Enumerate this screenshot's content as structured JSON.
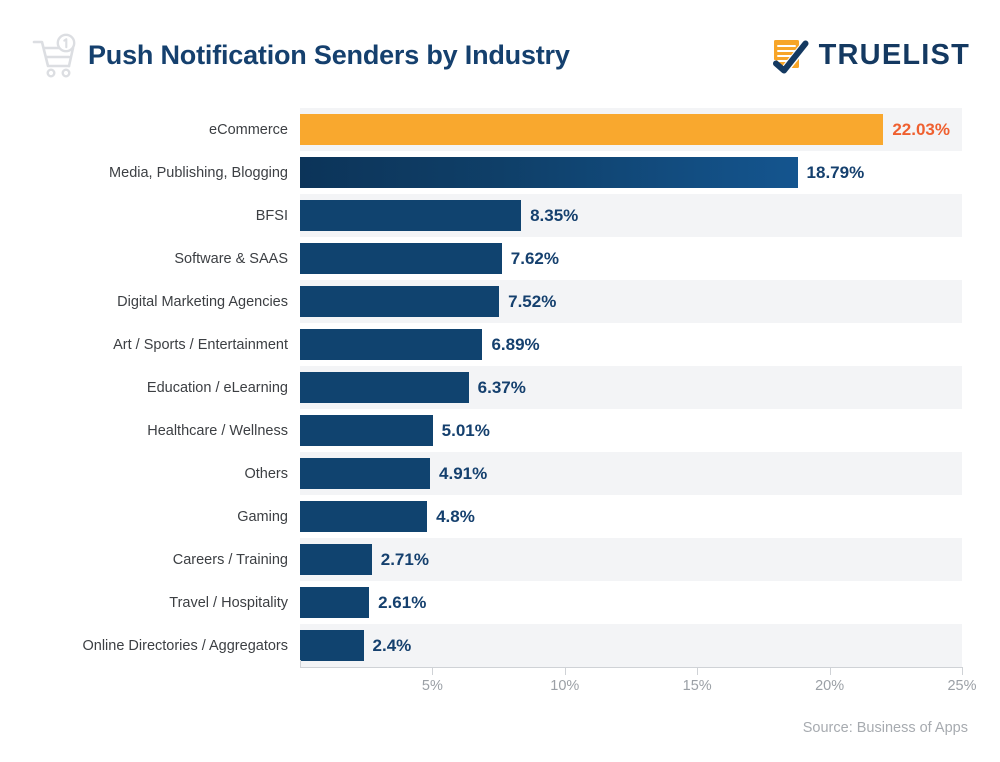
{
  "header": {
    "title": "Push Notification Senders by Industry",
    "cart_icon": "shopping-cart-icon",
    "brand_name": "TRUELIST",
    "brand_mark_icon": "checklist-check-icon"
  },
  "footer": {
    "source": "Source: Business of Apps"
  },
  "colors": {
    "title": "#15406e",
    "bar_default": "#10436f",
    "bar_highlight": "#f9a82e",
    "bar_gradient_start": "#0c3459",
    "bar_gradient_end": "#14558f",
    "value_label": "#15406e",
    "value_label_accent": "#ef6030",
    "band": "#f3f4f6",
    "axis": "#cfd2d6",
    "tick_label": "#9ba0a6",
    "category_label": "#3c3f43",
    "source_text": "#a7abb0"
  },
  "chart_data": {
    "type": "bar",
    "orientation": "horizontal",
    "title": "Push Notification Senders by Industry",
    "subtitle": "",
    "xlabel": "",
    "ylabel": "",
    "xlim": [
      0,
      25
    ],
    "grid": false,
    "legend": "none",
    "source": "Source: Business of Apps",
    "tick_labels": [
      "5%",
      "10%",
      "15%",
      "20%",
      "25%"
    ],
    "ticks": [
      5,
      10,
      15,
      20,
      25
    ],
    "categories": [
      "eCommerce",
      "Media, Publishing, Blogging",
      "BFSI",
      "Software & SAAS",
      "Digital Marketing Agencies",
      "Art / Sports / Entertainment",
      "Education / eLearning",
      "Healthcare / Wellness",
      "Others",
      "Gaming",
      "Careers / Training",
      "Travel / Hospitality",
      "Online Directories / Aggregators"
    ],
    "values": [
      22.03,
      18.79,
      8.35,
      7.62,
      7.52,
      6.89,
      6.37,
      5.01,
      4.91,
      4.8,
      2.71,
      2.61,
      2.4
    ],
    "value_labels": [
      "22.03%",
      "18.79%",
      "8.35%",
      "7.62%",
      "7.52%",
      "6.89%",
      "6.37%",
      "5.01%",
      "4.91%",
      "4.8%",
      "2.71%",
      "2.61%",
      "2.4%"
    ],
    "bar_styles": [
      "highlight",
      "gradient",
      "solid",
      "solid",
      "solid",
      "solid",
      "solid",
      "solid",
      "solid",
      "solid",
      "solid",
      "solid",
      "solid"
    ],
    "label_styles": [
      "accent",
      "default",
      "default",
      "default",
      "default",
      "default",
      "default",
      "default",
      "default",
      "default",
      "default",
      "default",
      "default"
    ]
  }
}
